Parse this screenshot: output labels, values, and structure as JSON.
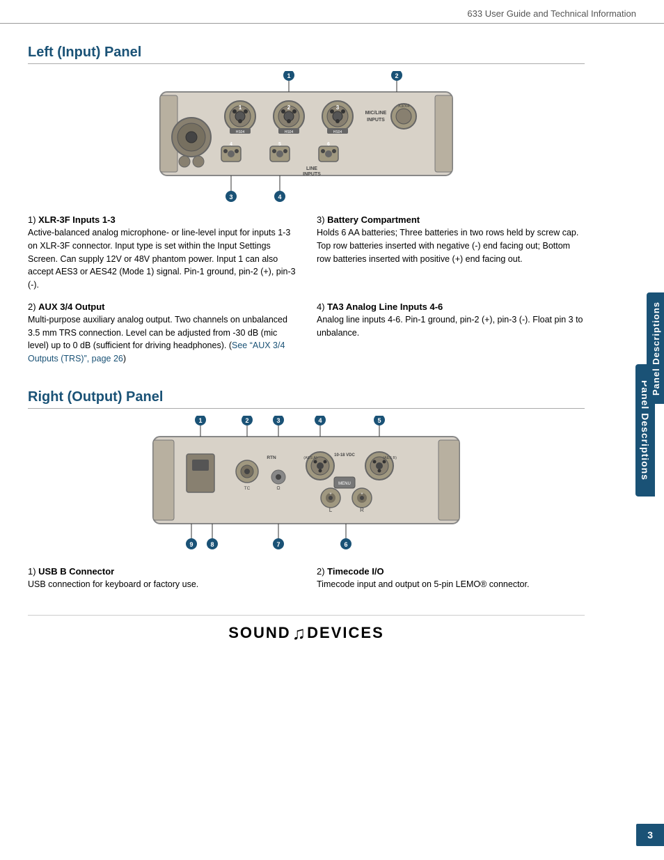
{
  "header": {
    "title": "633 User Guide and Technical Information"
  },
  "page_number": "3",
  "side_tab": "Panel Descriptions",
  "left_panel": {
    "heading": "Left (Input) Panel",
    "items": [
      {
        "number": "1)",
        "title": "XLR-3F Inputs 1-3",
        "body": "Active-balanced analog microphone- or line-level input for inputs 1-3 on XLR-3F connector. Input type is set within the Input Settings Screen. Can supply 12V or 48V phantom power. Input 1 can also accept AES3 or AES42 (Mode 1) signal. Pin-1 ground, pin-2 (+), pin-3 (-)."
      },
      {
        "number": "2)",
        "title": "AUX 3/4 Output",
        "body": "Multi-purpose auxiliary analog output. Two channels on unbalanced 3.5 mm TRS connection. Level can be adjusted from -30 dB (mic level) up to 0 dB (sufficient for driving headphones). (",
        "link": "See “AUX 3/4 Outputs (TRS)”, page 26",
        "body_end": ")"
      },
      {
        "number": "3)",
        "title": "Battery Compartment",
        "body": "Holds 6 AA batteries; Three batteries in two rows held by screw cap. Top row batteries inserted with negative (-) end facing out; Bottom row batteries inserted with positive (+) end facing out."
      },
      {
        "number": "4)",
        "title": "TA3 Analog Line Inputs 4-6",
        "body": "Analog line inputs 4-6. Pin-1 ground, pin-2 (+), pin-3 (-). Float pin 3 to unbalance."
      }
    ]
  },
  "right_panel": {
    "heading": "Right (Output) Panel",
    "items": [
      {
        "number": "1)",
        "title": "USB B Connector",
        "body": "USB connection for keyboard or factory use."
      },
      {
        "number": "2)",
        "title": "Timecode I/O",
        "body": "Timecode input and output on 5-pin LEMO® connector."
      }
    ]
  },
  "brand": {
    "text_left": "SOUND",
    "text_right": "DEVICES"
  }
}
